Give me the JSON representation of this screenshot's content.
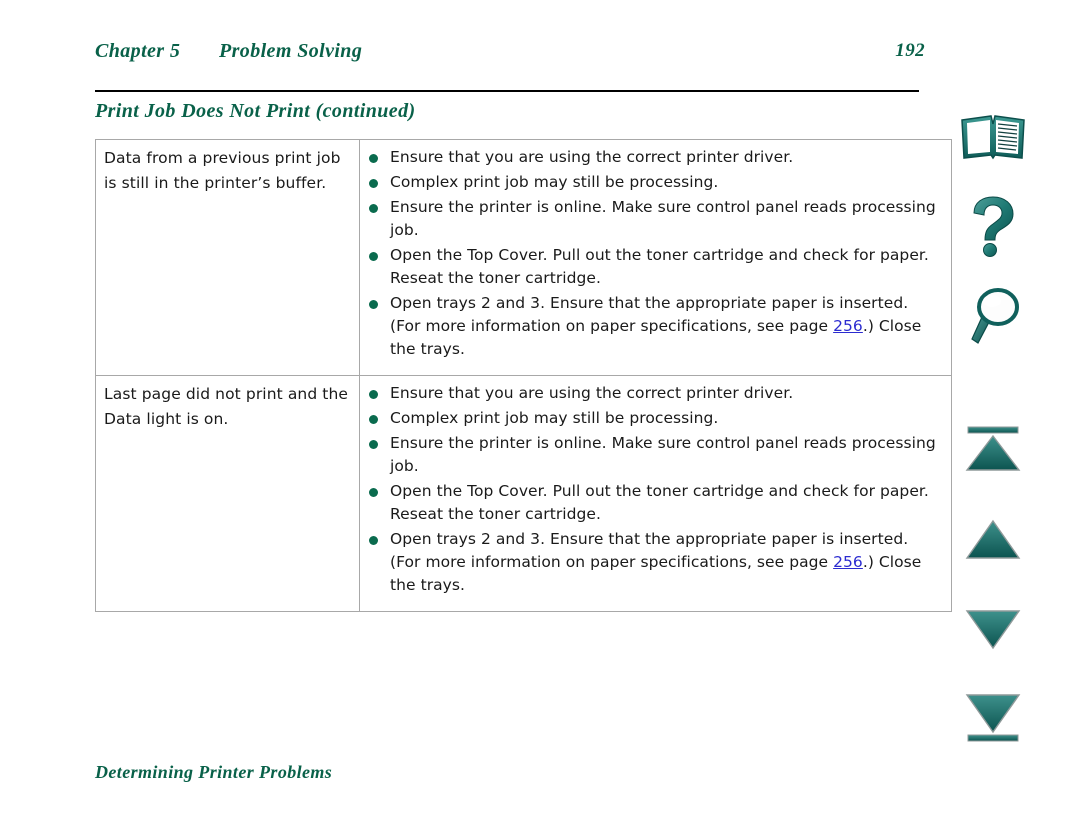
{
  "header": {
    "chapter_label": "Chapter 5",
    "chapter_title": "Problem Solving",
    "page_number": "192",
    "section_title": "Print Job Does Not Print (continued)"
  },
  "footer": {
    "title": "Determining Printer Problems"
  },
  "colors": {
    "heading_green": "#096149",
    "bullet_green": "#0a6b4e",
    "link_blue": "#2b2bd0",
    "icon_teal": "#1f7a74",
    "table_border": "#a8a8a8",
    "rule_black": "#000000"
  },
  "table": {
    "rows": [
      {
        "cause": "Data from a previous print job is still in the printer’s buffer.",
        "solutions": [
          {
            "text_before": "Ensure that you are using the correct printer driver.",
            "link": "",
            "text_after": ""
          },
          {
            "text_before": "Complex print job may still be processing.",
            "link": "",
            "text_after": ""
          },
          {
            "text_before": "Ensure the printer is online. Make sure control panel reads processing job.",
            "link": "",
            "text_after": ""
          },
          {
            "text_before": "Open the Top Cover. Pull out the toner cartridge and check for paper. Reseat the toner cartridge.",
            "link": "",
            "text_after": ""
          },
          {
            "text_before": "Open trays 2 and 3. Ensure that the appropriate paper is inserted. (For more information on paper specifications, see page ",
            "link": "256",
            "text_after": ".) Close the trays."
          }
        ]
      },
      {
        "cause": "Last page did not print and the Data light is on.",
        "solutions": [
          {
            "text_before": "Ensure that you are using the correct printer driver.",
            "link": "",
            "text_after": ""
          },
          {
            "text_before": "Complex print job may still be processing.",
            "link": "",
            "text_after": ""
          },
          {
            "text_before": "Ensure the printer is online. Make sure control panel reads processing job.",
            "link": "",
            "text_after": ""
          },
          {
            "text_before": "Open the Top Cover. Pull out the toner cartridge and check for paper. Reseat the toner cartridge.",
            "link": "",
            "text_after": ""
          },
          {
            "text_before": "Open trays 2 and 3. Ensure that the appropriate paper is inserted. (For more information on paper specifications, see page ",
            "link": "256",
            "text_after": ".) Close the trays."
          }
        ]
      }
    ]
  },
  "nav_rail": {
    "buttons": [
      {
        "id": "nav-book",
        "icon": "open-book-icon",
        "label": "Contents"
      },
      {
        "id": "nav-help",
        "icon": "question-mark-icon",
        "label": "Help"
      },
      {
        "id": "nav-search",
        "icon": "magnifying-glass-icon",
        "label": "Search"
      },
      {
        "id": "nav-first",
        "icon": "first-page-icon",
        "label": "First Page"
      },
      {
        "id": "nav-prev",
        "icon": "previous-page-icon",
        "label": "Previous Page"
      },
      {
        "id": "nav-next",
        "icon": "next-page-icon",
        "label": "Next Page"
      },
      {
        "id": "nav-last",
        "icon": "last-page-icon",
        "label": "Last Page"
      }
    ]
  }
}
